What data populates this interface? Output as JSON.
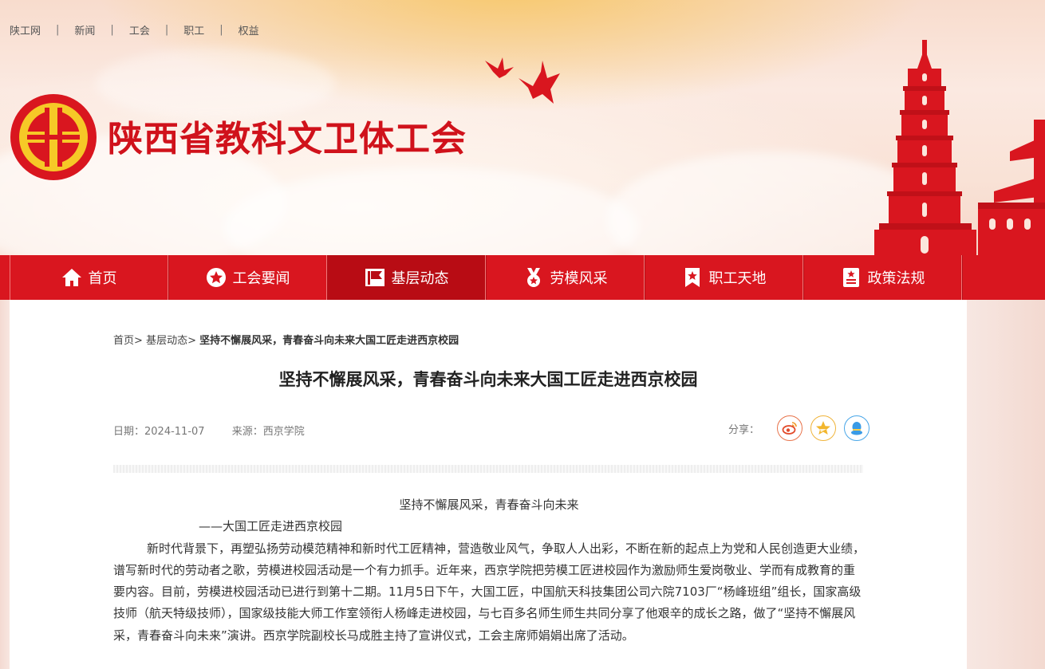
{
  "top_links": [
    "陕工网",
    "新闻",
    "工会",
    "职工",
    "权益"
  ],
  "site": {
    "title": "陕西省教科文卫体工会",
    "colors": {
      "brand_red": "#d9161f",
      "nav_active": "#b80c14",
      "logo_yellow": "#f6c927"
    }
  },
  "nav": [
    {
      "label": "首页",
      "icon": "home-icon"
    },
    {
      "label": "工会要闻",
      "icon": "star-circle-icon"
    },
    {
      "label": "基层动态",
      "icon": "flag-icon",
      "active": true
    },
    {
      "label": "劳模风采",
      "icon": "medal-icon"
    },
    {
      "label": "职工天地",
      "icon": "bookmark-star-icon"
    },
    {
      "label": "政策法规",
      "icon": "document-star-icon"
    }
  ],
  "breadcrumb": {
    "home": "首页",
    "sep": ">",
    "section": "基层动态",
    "current": "坚持不懈展风采，青春奋斗向未来大国工匠走进西京校园"
  },
  "article": {
    "title": "坚持不懈展风采，青春奋斗向未来大国工匠走进西京校园",
    "date": "日期：2024-11-07",
    "source": "来源：西京学院",
    "share_label": "分享：",
    "share_icons": [
      "weibo-icon",
      "qzone-icon",
      "qq-icon"
    ],
    "lines": {
      "subtitle": "坚持不懈展风采，青春奋斗向未来",
      "sub2": "——大国工匠走进西京校园",
      "paragraph": "新时代背景下，再塑弘扬劳动模范精神和新时代工匠精神，营造敬业风气，争取人人出彩，不断在新的起点上为党和人民创造更大业绩，谱写新时代的劳动者之歌，劳模进校园活动是一个有力抓手。近年来，西京学院把劳模工匠进校园作为激励师生爱岗敬业、学而有成教育的重要内容。目前，劳模进校园活动已进行到第十二期。11月5日下午，大国工匠，中国航天科技集团公司六院7103厂“杨峰班组”组长，国家高级技师（航天特级技师），国家级技能大师工作室领衔人杨峰走进校园，与七百多名师生师生共同分享了他艰辛的成长之路，做了“坚持不懈展风采，青春奋斗向未来”演讲。西京学院副校长马成胜主持了宣讲仪式，工会主席师娟娟出席了活动。"
    }
  }
}
